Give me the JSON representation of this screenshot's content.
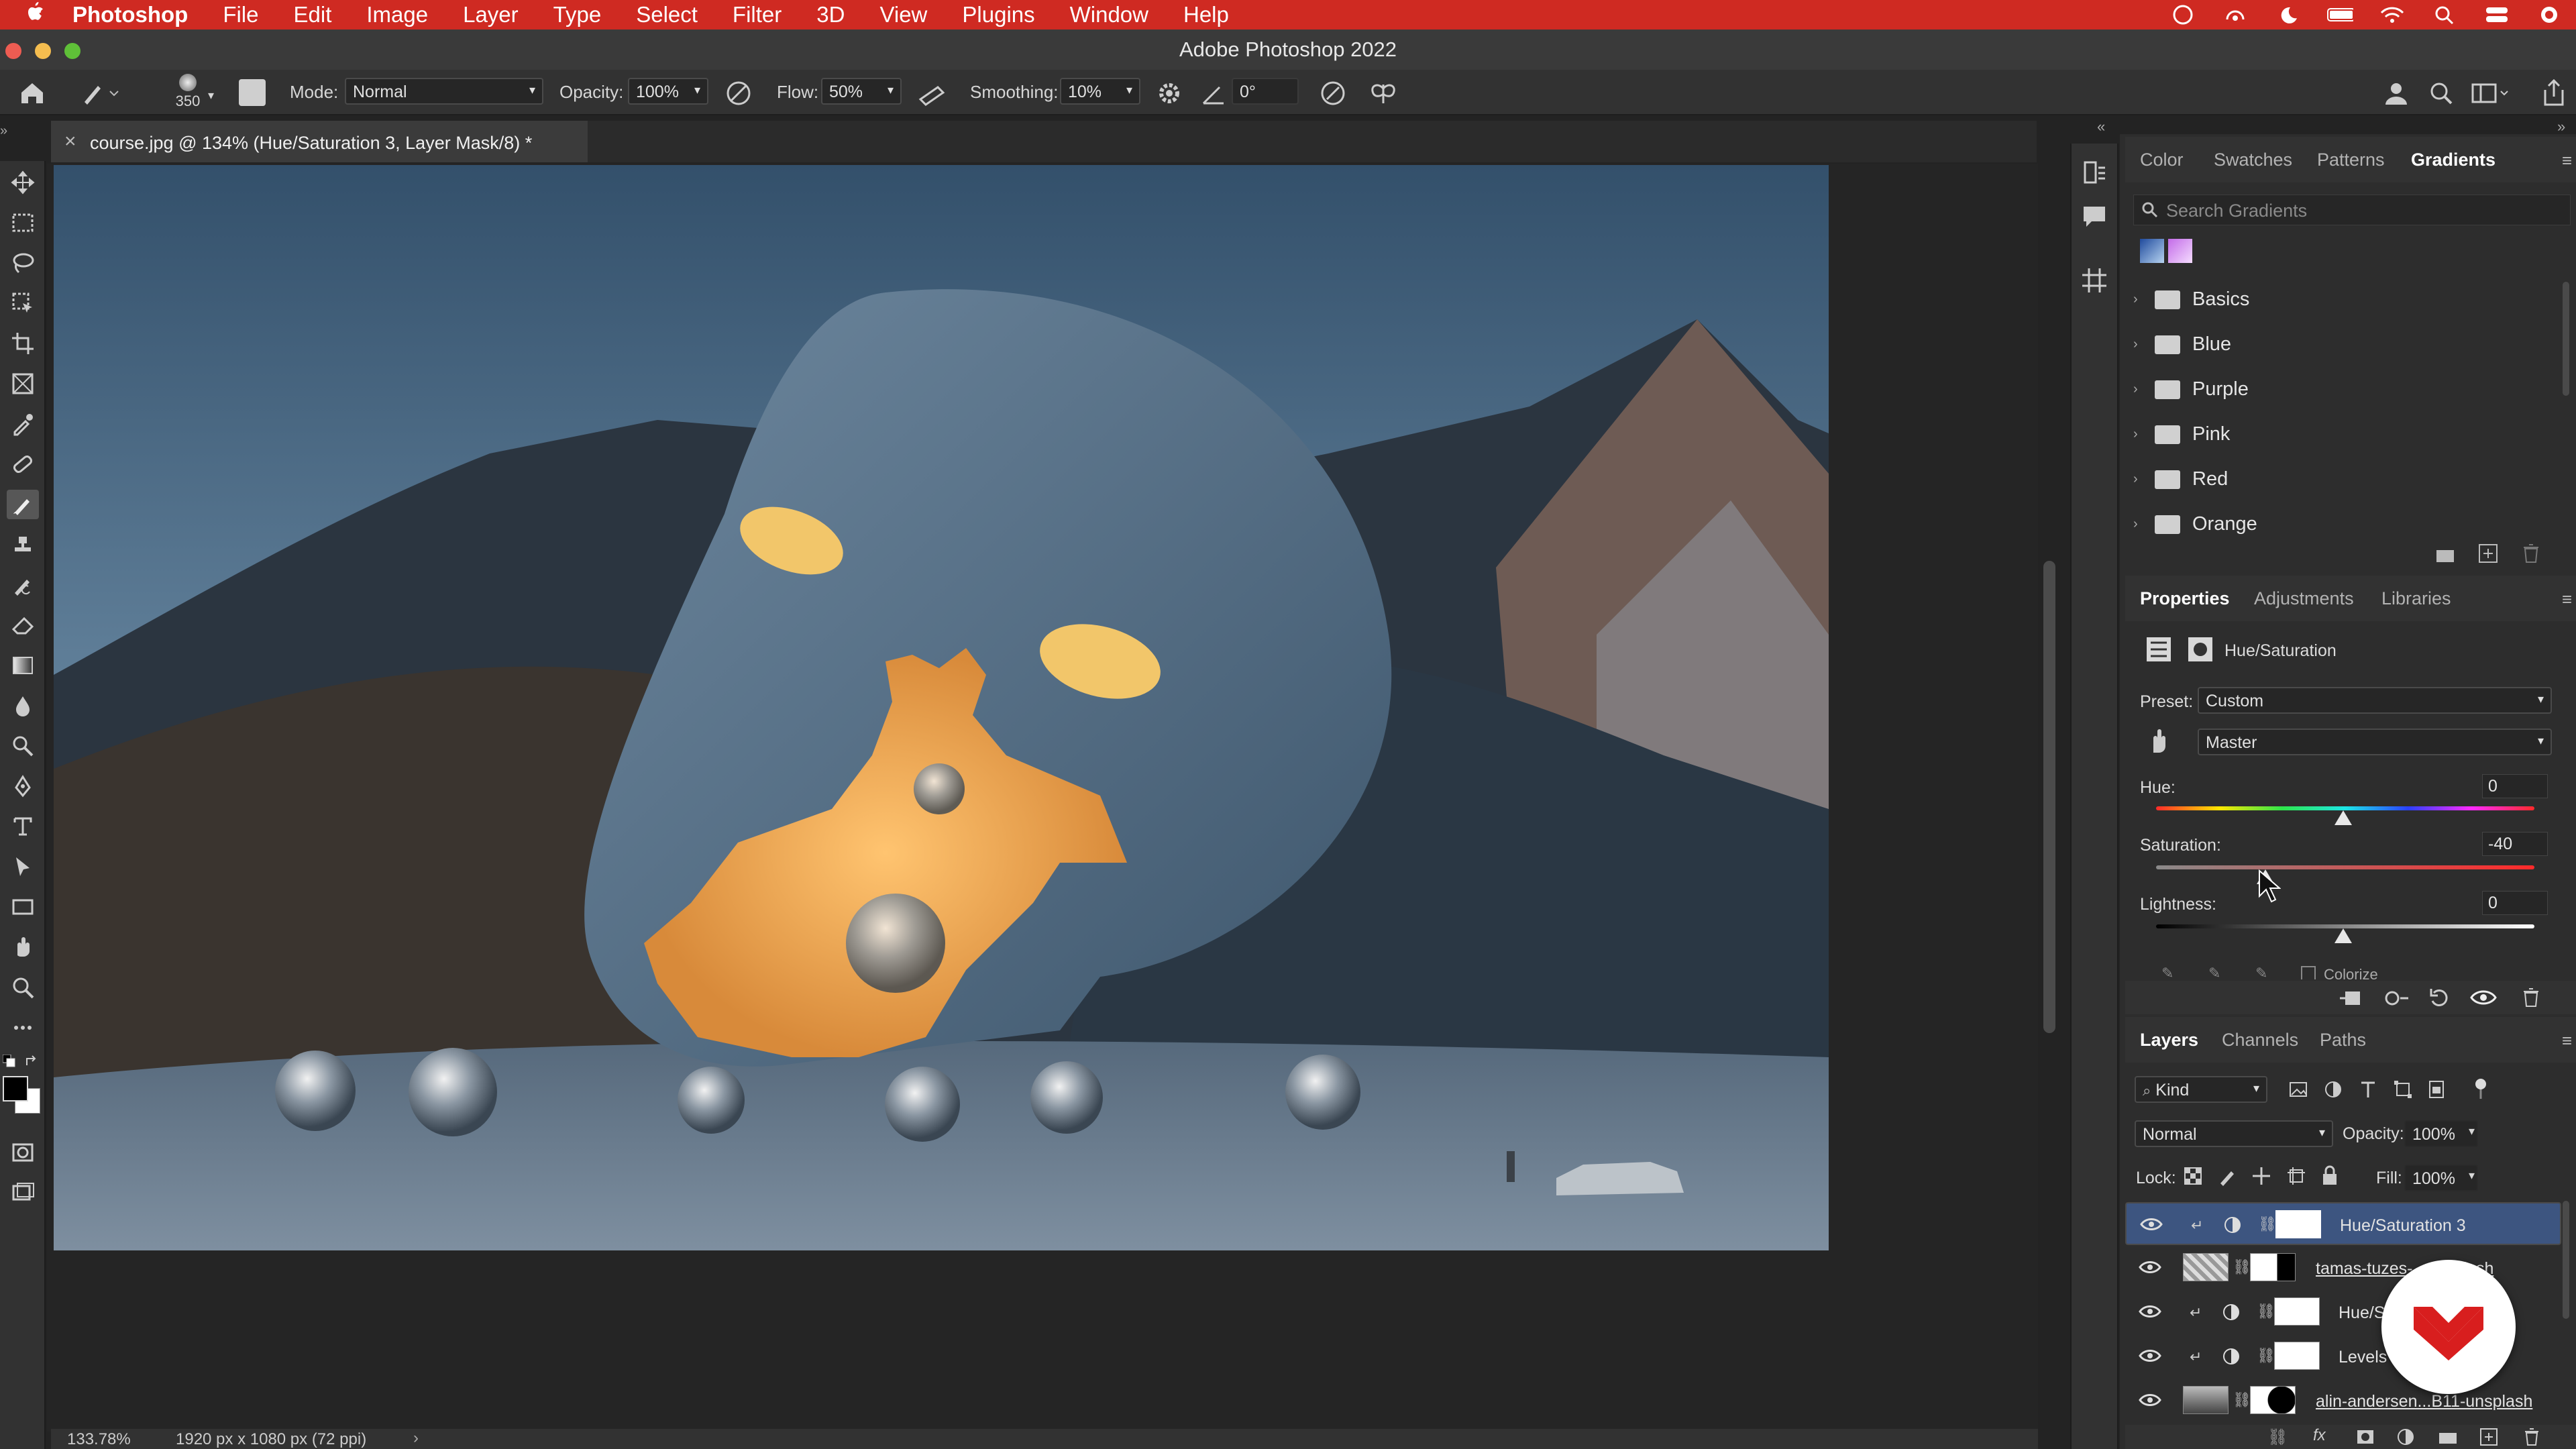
{
  "menubar": {
    "apple": "",
    "app": "Photoshop",
    "items": [
      "File",
      "Edit",
      "Image",
      "Layer",
      "Type",
      "Select",
      "Filter",
      "3D",
      "View",
      "Plugins",
      "Window",
      "Help"
    ]
  },
  "titlebar": {
    "title": "Adobe Photoshop 2022"
  },
  "options": {
    "brush_size": "350",
    "mode_label": "Mode:",
    "mode_value": "Normal",
    "opacity_label": "Opacity:",
    "opacity_value": "100%",
    "flow_label": "Flow:",
    "flow_value": "50%",
    "smoothing_label": "Smoothing:",
    "smoothing_value": "10%",
    "angle_value": "0°"
  },
  "document": {
    "tab_label": "course.jpg @ 134% (Hue/Saturation 3, Layer Mask/8) *",
    "close": "×"
  },
  "status": {
    "zoom": "133.78%",
    "dimensions": "1920 px x 1080 px (72 ppi)"
  },
  "swatch_panel": {
    "tabs": [
      "Color",
      "Swatches",
      "Patterns",
      "Gradients"
    ],
    "active_tab": "Gradients",
    "search_placeholder": "Search Gradients",
    "folders": [
      "Basics",
      "Blue",
      "Purple",
      "Pink",
      "Red",
      "Orange"
    ]
  },
  "properties_panel": {
    "tabs": [
      "Properties",
      "Adjustments",
      "Libraries"
    ],
    "active_tab": "Properties",
    "adjustment_name": "Hue/Saturation",
    "preset_label": "Preset:",
    "preset_value": "Custom",
    "channel_value": "Master",
    "hue_label": "Hue:",
    "hue_value": "0",
    "saturation_label": "Saturation:",
    "saturation_value": "-40",
    "lightness_label": "Lightness:",
    "lightness_value": "0",
    "colorize_label": "Colorize"
  },
  "layers_panel": {
    "tabs": [
      "Layers",
      "Channels",
      "Paths"
    ],
    "active_tab": "Layers",
    "filter_label": "Kind",
    "blend_mode": "Normal",
    "opacity_label": "Opacity:",
    "opacity_value": "100%",
    "lock_label": "Lock:",
    "fill_label": "Fill:",
    "fill_value": "100%",
    "layers": [
      {
        "name": "Hue/Saturation 3",
        "selected": true
      },
      {
        "name": "tamas-tuzes-...unsplash",
        "selected": false
      },
      {
        "name": "Hue/S...",
        "selected": false
      },
      {
        "name": "Levels",
        "selected": false
      },
      {
        "name": "alin-andersen...B11-unsplash",
        "selected": false
      }
    ]
  },
  "colors": {
    "menubar": "#cf2a22",
    "selected_layer": "#3d5580"
  }
}
